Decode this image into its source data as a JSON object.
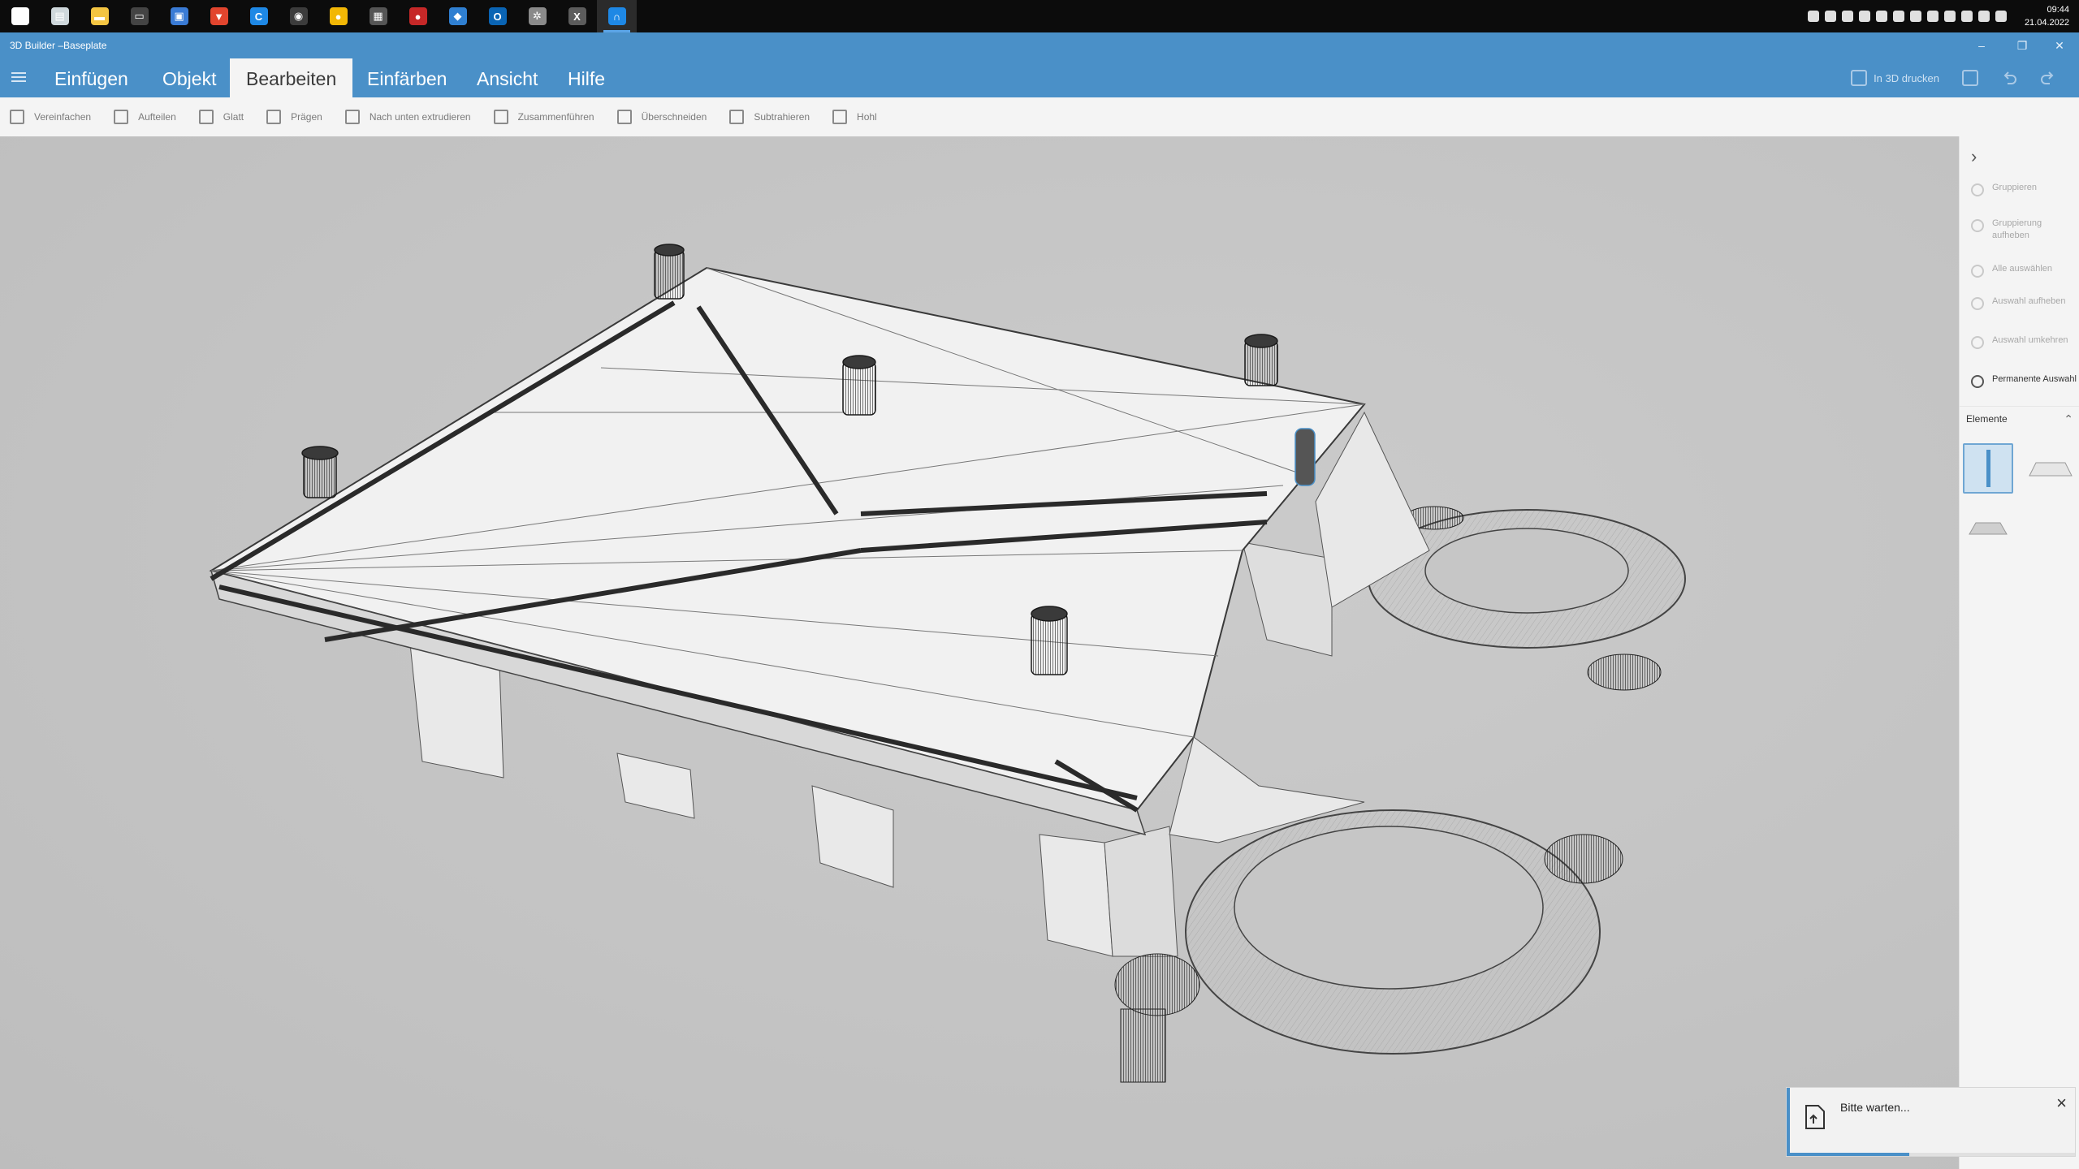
{
  "taskbar": {
    "icons": [
      {
        "name": "windows-start-icon",
        "color": "#ffffff",
        "glyph": "⊞"
      },
      {
        "name": "file-manager-icon",
        "color": "#cfd8dc",
        "glyph": "▤"
      },
      {
        "name": "folder-icon",
        "color": "#f4c542",
        "glyph": "▬"
      },
      {
        "name": "terminal-icon",
        "color": "#444444",
        "glyph": "▭"
      },
      {
        "name": "floppy-disk-icon",
        "color": "#3a7bd5",
        "glyph": "▣"
      },
      {
        "name": "brave-browser-icon",
        "color": "#e2452e",
        "glyph": "▼"
      },
      {
        "name": "ccleaner-icon",
        "color": "#1e88e5",
        "glyph": "C"
      },
      {
        "name": "media-player-icon",
        "color": "#3c3c3c",
        "glyph": "◉"
      },
      {
        "name": "yellow-app-icon",
        "color": "#f2b705",
        "glyph": "●"
      },
      {
        "name": "grid-app-icon",
        "color": "#555555",
        "glyph": "▦"
      },
      {
        "name": "red-app-icon",
        "color": "#c62828",
        "glyph": "●"
      },
      {
        "name": "chat-app-icon",
        "color": "#2f7fd1",
        "glyph": "◆"
      },
      {
        "name": "outlook-icon",
        "color": "#0a64b4",
        "glyph": "O"
      },
      {
        "name": "settings-gear-app-icon",
        "color": "#8a8a8a",
        "glyph": "✲"
      },
      {
        "name": "excel-icon",
        "color": "#5c5c5c",
        "glyph": "X"
      },
      {
        "name": "3d-builder-taskbar-icon",
        "color": "#1e88e5",
        "glyph": "∩"
      }
    ],
    "clock_time": "09:44",
    "clock_date": "21.04.2022"
  },
  "window": {
    "title": "3D Builder –Baseplate",
    "minimize": "–",
    "restore": "❐",
    "close": "✕"
  },
  "ribbon": {
    "tabs": [
      {
        "label": "Einfügen",
        "active": false
      },
      {
        "label": "Objekt",
        "active": false
      },
      {
        "label": "Bearbeiten",
        "active": true
      },
      {
        "label": "Einfärben",
        "active": false
      },
      {
        "label": "Ansicht",
        "active": false
      },
      {
        "label": "Hilfe",
        "active": false
      }
    ],
    "print_label": "In 3D drucken"
  },
  "toolbar": {
    "tools": [
      {
        "label": "Vereinfachen",
        "icon": "simplify-icon"
      },
      {
        "label": "Aufteilen",
        "icon": "split-icon"
      },
      {
        "label": "Glatt",
        "icon": "smooth-icon"
      },
      {
        "label": "Prägen",
        "icon": "emboss-star-icon"
      },
      {
        "label": "Nach unten extrudieren",
        "icon": "extrude-down-icon"
      },
      {
        "label": "Zusammenführen",
        "icon": "merge-icon"
      },
      {
        "label": "Überschneiden",
        "icon": "intersect-icon"
      },
      {
        "label": "Subtrahieren",
        "icon": "subtract-icon"
      },
      {
        "label": "Hohl",
        "icon": "hollow-icon"
      }
    ]
  },
  "panel": {
    "actions": [
      {
        "label": "Gruppieren",
        "enabled": false
      },
      {
        "label": "Gruppierung aufheben",
        "enabled": false
      },
      {
        "label": "Alle auswählen",
        "enabled": false
      },
      {
        "label": "Auswahl aufheben",
        "enabled": false
      },
      {
        "label": "Auswahl umkehren",
        "enabled": false
      },
      {
        "label": "Permanente Auswahl",
        "enabled": true
      }
    ],
    "elements_header": "Elemente"
  },
  "toast": {
    "message": "Bitte warten...",
    "progress": 0.42
  },
  "colors": {
    "accent": "#4a90c8",
    "viewport_bg": "#c6c6c6",
    "panel_bg": "#f4f4f4"
  }
}
